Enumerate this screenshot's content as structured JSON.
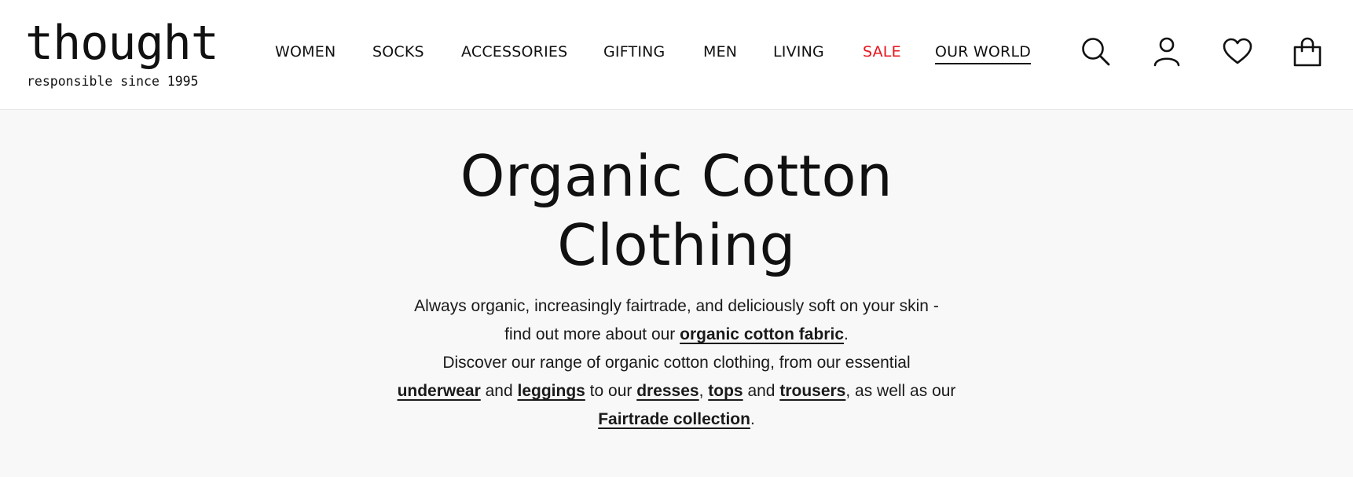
{
  "brand": {
    "logo_text": "thought",
    "tagline": "responsible since 1995"
  },
  "nav": {
    "items": [
      {
        "label": "WOMEN"
      },
      {
        "label": "SOCKS"
      },
      {
        "label": "ACCESSORIES"
      },
      {
        "label": "GIFTING"
      },
      {
        "label": "MEN"
      },
      {
        "label": "LIVING"
      },
      {
        "label": "SALE",
        "color": "#e8141b"
      },
      {
        "label": "OUR WORLD",
        "active": true
      }
    ]
  },
  "header_icons": [
    {
      "name": "search-icon"
    },
    {
      "name": "account-icon"
    },
    {
      "name": "wishlist-heart-icon"
    },
    {
      "name": "shopping-bag-icon"
    }
  ],
  "hero": {
    "title_line1": "Organic Cotton",
    "title_line2": "Clothing",
    "line1": "Always organic, increasingly fairtrade, and deliciously soft on your skin -",
    "line2_prefix": "find out more about our ",
    "link_fabric": "organic cotton fabric",
    "line2_suffix": ".",
    "line3": "Discover our range of organic cotton clothing, from our essential",
    "link_underwear": "underwear",
    "and1": " and ",
    "link_leggings": "leggings",
    "to_our": " to our ",
    "link_dresses": "dresses",
    "comma": ", ",
    "link_tops": "tops",
    "and2": " and ",
    "link_trousers": "trousers",
    "as_well": ", as well as our",
    "link_fairtrade": "Fairtrade collection",
    "period": "."
  },
  "colors": {
    "background": "#f8f8f8",
    "header_bg": "#ffffff",
    "text": "#111111",
    "sale": "#e8141b"
  }
}
